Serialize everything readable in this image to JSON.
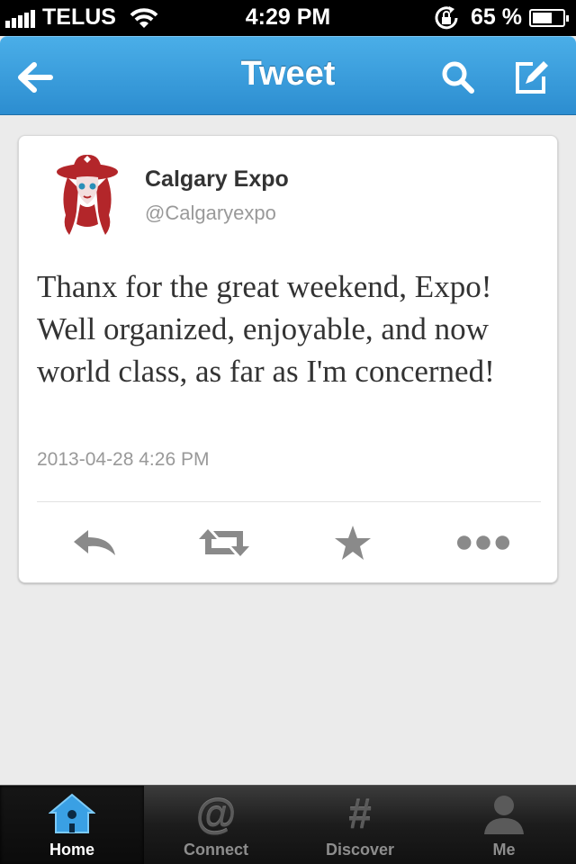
{
  "status_bar": {
    "carrier": "TELUS",
    "time": "4:29 PM",
    "battery": "65 %",
    "battery_level": 0.65
  },
  "nav": {
    "title": "Tweet",
    "back_icon": "back-arrow-icon",
    "search_icon": "search-icon",
    "compose_icon": "compose-icon"
  },
  "tweet": {
    "user_name": "Calgary Expo",
    "user_handle": "@Calgaryexpo",
    "text": "Thanx for the great weekend, Expo! Well organized, enjoyable, and now world class, as far as I'm concerned!",
    "timestamp": "2013-04-28 4:26 PM",
    "actions": [
      "reply-icon",
      "retweet-icon",
      "favorite-star-icon",
      "more-icon"
    ]
  },
  "tab_bar": {
    "tabs": [
      {
        "label": "Home",
        "icon": "home-icon",
        "active": true
      },
      {
        "label": "Connect",
        "icon": "at-sign-icon",
        "active": false
      },
      {
        "label": "Discover",
        "icon": "hashtag-icon",
        "active": false
      },
      {
        "label": "Me",
        "icon": "person-icon",
        "active": false
      }
    ]
  },
  "colors": {
    "nav_blue": "#2c8dd0",
    "avatar_red": "#b3262a",
    "background": "#ebebeb"
  }
}
